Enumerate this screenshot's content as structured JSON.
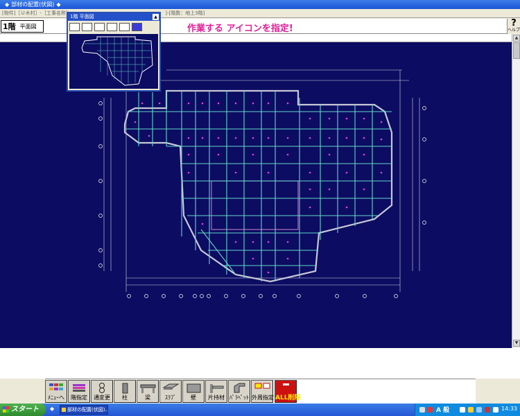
{
  "window": {
    "title": "部材の配置(伏図)"
  },
  "info_bar": {
    "left": "[物件]［Ｕ木村］-［工事名称］",
    "right": "]-[階数：地上3階]"
  },
  "toolbar": {
    "floor": "1階",
    "view": "平面図",
    "instruction": "作業する アイコンを指定!",
    "help_label": "ヘルプ"
  },
  "minimap": {
    "title": "1階 平面図"
  },
  "bottom_tools": [
    {
      "name": "menu",
      "label": "ﾒﾆｭｰへ"
    },
    {
      "name": "floor-select",
      "label": "階指定"
    },
    {
      "name": "grid-change",
      "label": "通変更"
    },
    {
      "name": "column",
      "label": "柱"
    },
    {
      "name": "beam",
      "label": "梁"
    },
    {
      "name": "slab",
      "label": "ｽﾗﾌﾞ"
    },
    {
      "name": "wall",
      "label": "壁"
    },
    {
      "name": "cantilever",
      "label": "片持材"
    },
    {
      "name": "parapet",
      "label": "ﾊﾟﾗﾍﾟｯﾄ"
    },
    {
      "name": "perimeter",
      "label": "外周指定"
    },
    {
      "name": "delete-all",
      "label": "ALL削除"
    }
  ],
  "taskbar": {
    "start": "スタート",
    "task": "部材の配置(伏図)...",
    "ime": "A 般",
    "clock": "14:33"
  },
  "colors": {
    "canvas": "#0c0c62",
    "beam": "#62d8c8",
    "magenta": "#e040e0",
    "instruction": "#e0209a"
  }
}
